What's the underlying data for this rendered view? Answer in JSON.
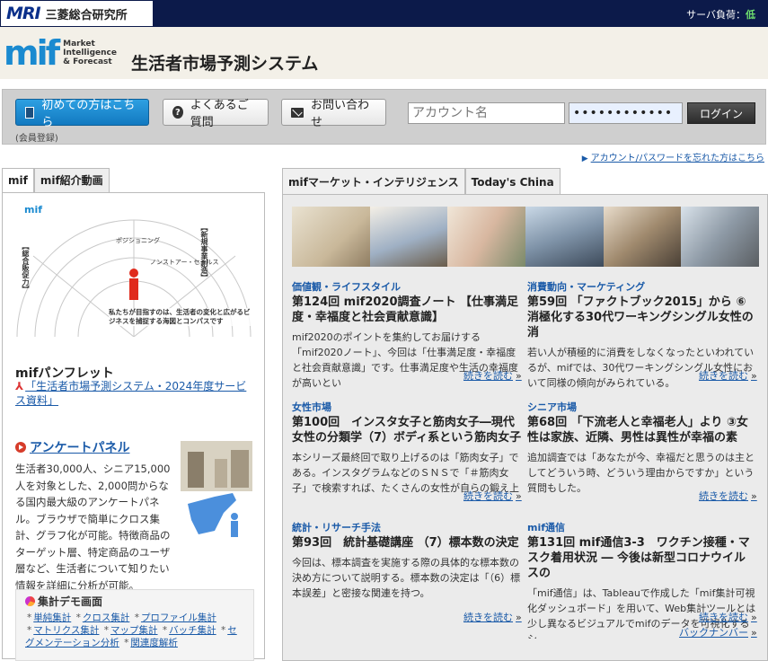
{
  "topbar": {
    "mri": "MRI",
    "company": "三菱総合研究所",
    "server_load_label": "サーバ負荷：",
    "server_load_value": "低"
  },
  "header": {
    "logo": "mif",
    "logo_sub_1": "Market",
    "logo_sub_2": "Intelligence",
    "logo_sub_3": "& Forecast",
    "title": "生活者市場予測システム"
  },
  "login": {
    "first_time": "初めての方はこちら",
    "member_note": "(会員登録)",
    "faq": "よくあるご質問",
    "contact": "お問い合わせ",
    "account_placeholder": "アカウント名",
    "password_value": "••••••••••••",
    "login_button": "ログイン",
    "forgot": "アカウント/パスワードを忘れた方はこちら"
  },
  "left": {
    "tabs": [
      "mif",
      "mif紹介動画"
    ],
    "diagram": {
      "logo": "mif",
      "label_left": "【総合販促力】",
      "label_right": "【新規事業創造】",
      "ring_1": "ポジショニング",
      "ring_2": "ノンストアー・セールス",
      "caption": "私たちが目指すのは、生活者の変化と広がるビジネスを捕捉する海図とコンパスです"
    },
    "pamphlet_title": "mifパンフレット",
    "pamphlet_link": "「生活者市場予測システム・2024年度サービス資料」",
    "panel_title": "アンケートパネル",
    "panel_text": "生活者30,000人、シニア15,000人を対象とした、2,000問からなる国内最大級のアンケートパネル。ブラウザで簡単にクロス集計、グラフ化が可能。特徴商品のターゲット層、特定商品のユーザ層など、生活者について知りたい情報を詳細に分析が可能。",
    "demo": {
      "title": "集計デモ画面",
      "links": [
        "単純集計",
        "クロス集計",
        "プロファイル集計",
        "マトリクス集計",
        "マップ集計",
        "バッチ集計",
        "セグメンテーション分析",
        "関連度解析"
      ]
    }
  },
  "right": {
    "tabs": [
      "mifマーケット・インテリジェンス",
      "Today's China"
    ],
    "more_label": "続きを読む",
    "backnumber": "バックナンバー",
    "articles": [
      {
        "category": "価値観・ライフスタイル",
        "title": "第124回 mif2020調査ノート 【仕事満足度・幸福度と社会貢献意識】",
        "desc": "mif2020のポイントを集約してお届けする「mif2020ノート」、今回は「仕事満足度・幸福度と社会貢献意識」です。仕事満足度や生活の幸福度が高いとい"
      },
      {
        "category": "消費動向・マーケティング",
        "title": "第59回 「ファクトブック2015」から ⑥消極化する30代ワーキングシングル女性の消",
        "desc": "若い人が積極的に消費をしなくなったといわれているが、mifでは、30代ワーキングシングル女性において同様の傾向がみられている。"
      },
      {
        "category": "女性市場",
        "title": "第100回　インスタ女子と筋肉女子―現代女性の分類学（7）ボディ系という筋肉女子",
        "desc": "本シリーズ最終回で取り上げるのは「筋肉女子」である。インスタグラムなどのＳＮＳで「＃筋肉女子」で検索すれば、たくさんの女性が自らの鍛え上"
      },
      {
        "category": "シニア市場",
        "title": "第68回 「下流老人と幸福老人」より ③女性は家族、近隣、男性は異性が幸福の素",
        "desc": "追加調査では「あなたが今、幸福だと思うのは主としてどういう時、どういう理由からですか」という質問もした。"
      },
      {
        "category": "統計・リサーチ手法",
        "title": "第93回　統計基礎講座 （7）標本数の決定",
        "desc": "今回は、標本調査を実施する際の具体的な標本数の決め方について説明する。標本数の決定は「（6）標本誤差」と密接な関連を持つ。"
      },
      {
        "category": "mif通信",
        "title": "第131回 mif通信3-3　ワクチン接種・マスク着用状況 ― 今後は新型コロナウイルスの",
        "desc": "「mif通信」は、Tableauで作成した「mif集計可視化ダッシュボード」を用いて、Web集計ツールとは少し異なるビジュアルでmifのデータを可視化するシ"
      }
    ]
  }
}
